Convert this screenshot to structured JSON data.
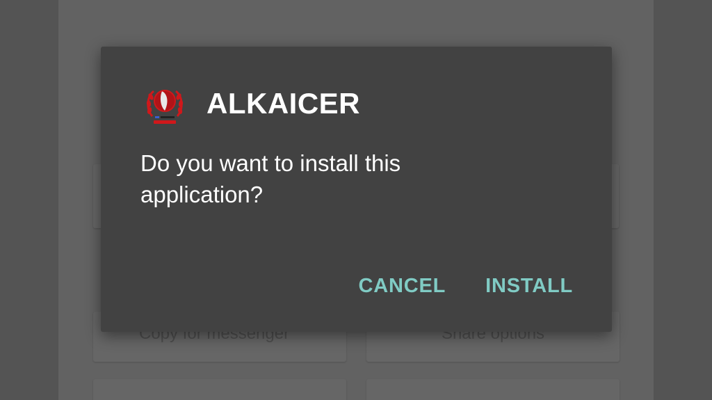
{
  "background": {
    "left_card_label": "Copy for messenger",
    "right_card_label": "Share options"
  },
  "dialog": {
    "app_name": "ALKAICER",
    "app_icon": "red-emblem-icon",
    "message": "Do you want to install this application?",
    "cancel_label": "CANCEL",
    "install_label": "INSTALL"
  },
  "colors": {
    "dialog_background": "#424242",
    "button_accent": "#80cbc4",
    "icon_red": "#d0181b",
    "scrim": "#5c5c5c"
  }
}
